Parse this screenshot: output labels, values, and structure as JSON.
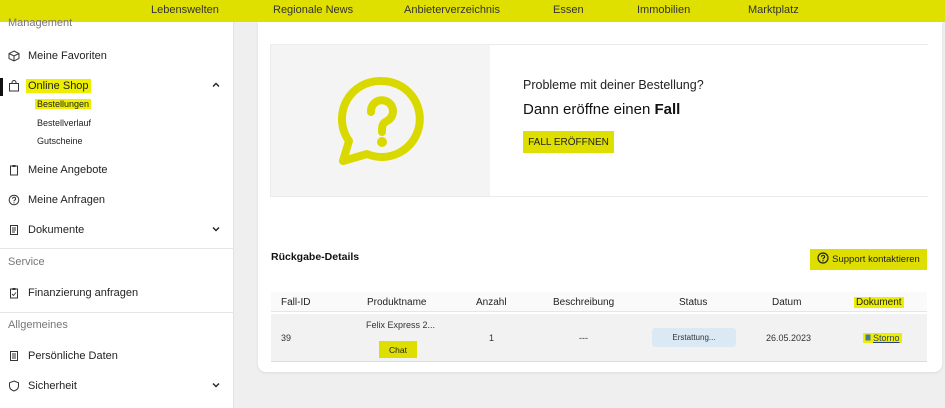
{
  "topnav": {
    "items": [
      "Lebenswelten",
      "Regionale News",
      "Anbieterverzeichnis",
      "Essen",
      "Immobilien",
      "Marktplatz"
    ]
  },
  "sidebar": {
    "section_management": "Management",
    "favoriten": "Meine Favoriten",
    "online_shop": "Online Shop",
    "sub_items": [
      "Bestellungen",
      "Bestellverlauf",
      "Gutscheine"
    ],
    "angebote": "Meine Angebote",
    "anfragen": "Meine Anfragen",
    "dokumente": "Dokumente",
    "section_service": "Service",
    "finanzierung": "Finanzierung anfragen",
    "section_allgemeines": "Allgemeines",
    "persoenliche_daten": "Persönliche Daten",
    "sicherheit": "Sicherheit"
  },
  "promo": {
    "question": "Probleme mit deiner Bestellung?",
    "heading_prefix": "Dann eröffne einen ",
    "heading_bold": "Fall",
    "button": "FALL ERÖFFNEN"
  },
  "returns": {
    "title": "Rückgabe-Details",
    "support_button": "Support kontaktieren",
    "columns": [
      "Fall-ID",
      "Produktname",
      "Anzahl",
      "Beschreibung",
      "Status",
      "Datum",
      "Dokument"
    ],
    "row": {
      "id": "39",
      "product": "Felix Express 2...",
      "chat": "Chat",
      "count": "1",
      "description": "---",
      "status": "Erstattung...",
      "date": "26.05.2023",
      "document": "Storno"
    }
  },
  "colors": {
    "accent_yellow": "#e0e000",
    "highlight_yellow": "#eeee00",
    "status_blue": "#dbe9f5"
  }
}
